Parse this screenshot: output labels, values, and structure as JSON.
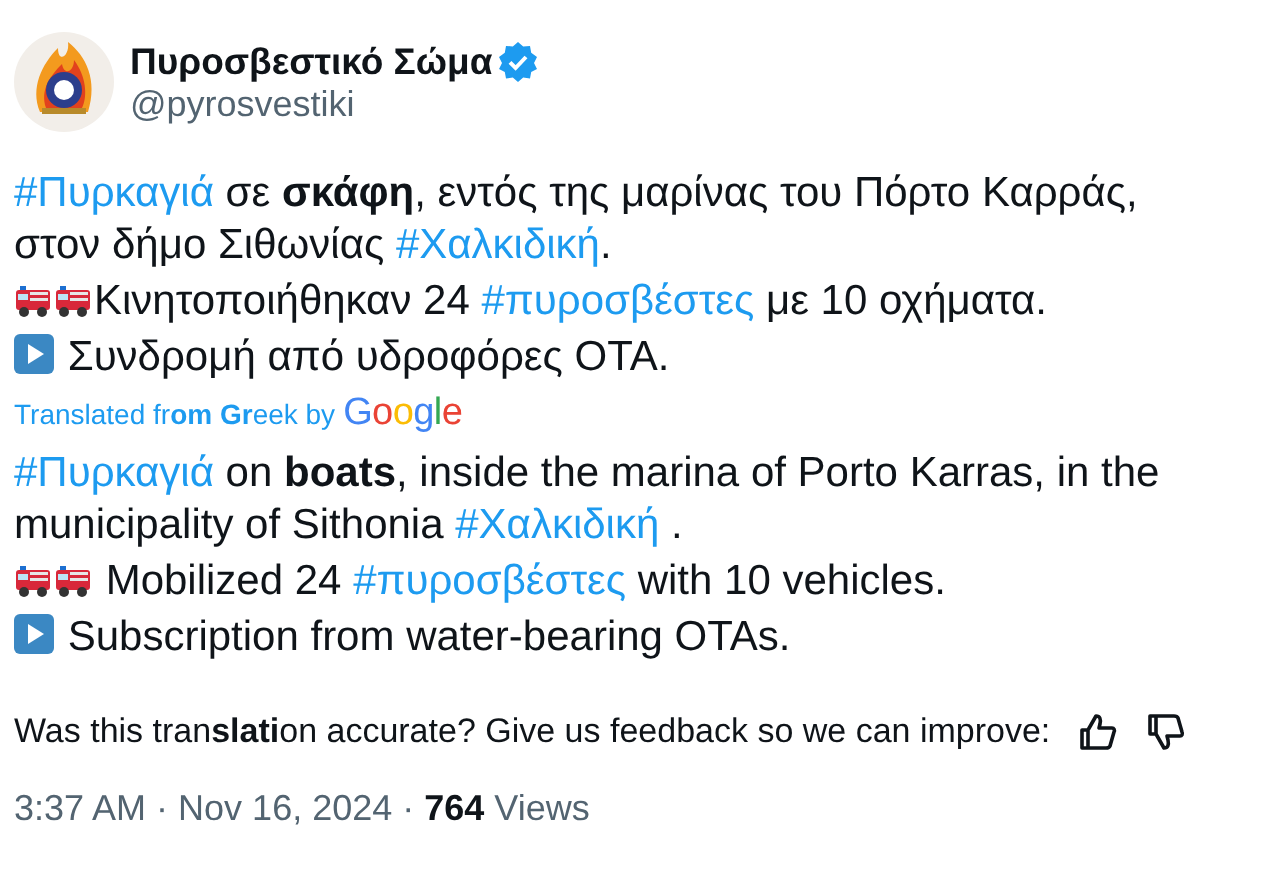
{
  "author": {
    "name": "Πυροσβεστικό Σώμα",
    "verified": true,
    "handle": "@pyrosvestiki"
  },
  "original": [
    {
      "kind": "plain",
      "segments": [
        {
          "kind": "hashtag",
          "text": "#Πυρκαγιά"
        },
        {
          "kind": "text",
          "text": " σε "
        },
        {
          "kind": "bold",
          "text": "σκάφη"
        },
        {
          "kind": "text",
          "text": ", εντός της μαρίνας του Πόρτο Καρράς, στον δήμο Σιθωνίας "
        },
        {
          "kind": "hashtag",
          "text": "#Χαλκιδική"
        },
        {
          "kind": "text",
          "text": "."
        }
      ]
    },
    {
      "kind": "trucks",
      "segments": [
        {
          "kind": "text",
          "text": "Κινητοποιήθηκαν 24 "
        },
        {
          "kind": "hashtag",
          "text": "#πυροσβέστες"
        },
        {
          "kind": "text",
          "text": " με 10 οχήματα."
        }
      ]
    },
    {
      "kind": "play",
      "segments": [
        {
          "kind": "text",
          "text": " Συνδρομή από υδροφόρες ΟΤΑ."
        }
      ]
    }
  ],
  "translation_note": {
    "text": "Translated fr**om** **Gr**eek by",
    "brand": "Google"
  },
  "translated": [
    {
      "kind": "plain",
      "segments": [
        {
          "kind": "hashtag",
          "text": "#Πυρκαγιά"
        },
        {
          "kind": "text",
          "text": " on "
        },
        {
          "kind": "bold",
          "text": "boats"
        },
        {
          "kind": "text",
          "text": ", inside the marina of Porto Karras, in the municipality of Sithonia "
        },
        {
          "kind": "hashtag",
          "text": "#Χαλκιδική"
        },
        {
          "kind": "text",
          "text": " ."
        }
      ]
    },
    {
      "kind": "trucks",
      "segments": [
        {
          "kind": "text",
          "text": " Mobilized 24 "
        },
        {
          "kind": "hashtag",
          "text": "#πυροσβέστες"
        },
        {
          "kind": "text",
          "text": " with 10 vehicles."
        }
      ]
    },
    {
      "kind": "play",
      "segments": [
        {
          "kind": "text",
          "text": " Subscription from water-bearing OTAs."
        }
      ]
    }
  ],
  "feedback": {
    "text": "Was this tran**slati**on accurate? Give us feedback so we can improve:"
  },
  "meta": {
    "time": "3:37 AM",
    "separator_1": "·",
    "date": "Nov 16, 2024",
    "separator_2": "·",
    "views_count": "764",
    "views_label": "Views"
  }
}
